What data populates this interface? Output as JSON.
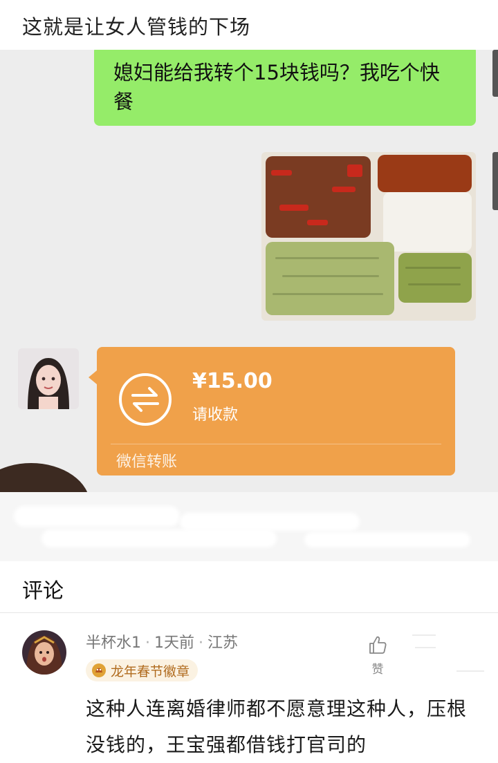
{
  "post": {
    "title": "这就是让女人管钱的下场"
  },
  "chat": {
    "outgoing_message": "媳妇能给我转个15块钱吗？我吃个快餐",
    "transfer": {
      "amount": "¥15.00",
      "status": "请收款",
      "footer": "微信转账"
    }
  },
  "comments": {
    "section_title": "评论",
    "items": [
      {
        "username": "半杯水1",
        "time": "1天前",
        "location": "江苏",
        "badge": "龙年春节徽章",
        "like_label": "赞",
        "text": "这种人连离婚律师都不愿意理这种人，压根没钱的，王宝强都借钱打官司的"
      }
    ]
  },
  "colors": {
    "chat_background": "#ededed",
    "outgoing_bubble": "#95ec69",
    "transfer_card": "#f0a14a",
    "badge_text": "#b06b1e"
  },
  "icons": {
    "transfer": "transfer-arrows-icon",
    "like": "thumbs-up-icon",
    "badge": "dragon-badge-icon"
  }
}
